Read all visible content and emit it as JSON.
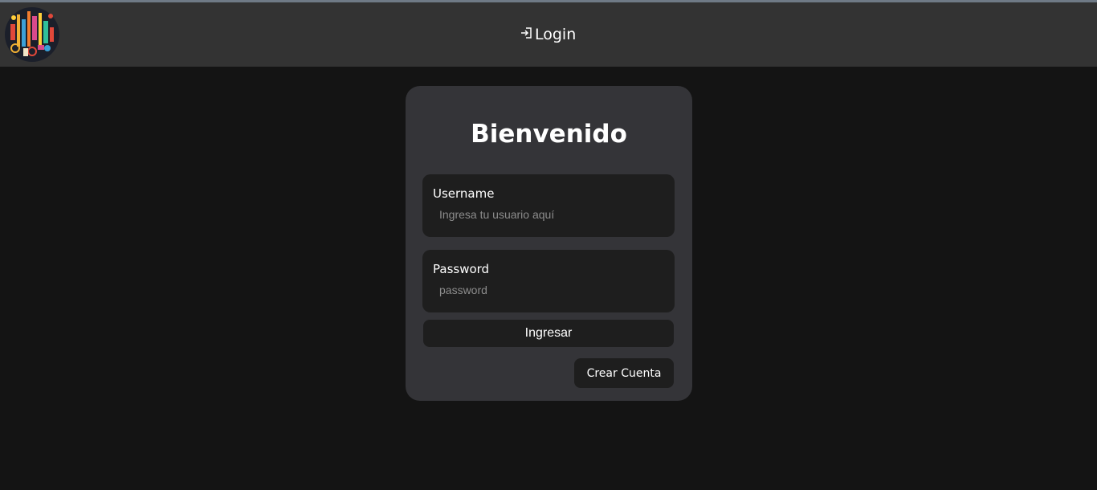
{
  "navbar": {
    "logo_icon": "tools-collage-logo",
    "login_icon": "login-arrow-icon",
    "login_label": "Login"
  },
  "card": {
    "title": "Bienvenido",
    "username": {
      "label": "Username",
      "placeholder": "Ingresa tu usuario aquí",
      "value": ""
    },
    "password": {
      "label": "Password",
      "placeholder": "password",
      "value": ""
    },
    "submit_label": "Ingresar",
    "create_account_label": "Crear Cuenta"
  },
  "colors": {
    "background": "#141414",
    "navbar": "#333333",
    "card": "#343438",
    "field": "#1e1e1e",
    "text": "#ffffff",
    "placeholder": "#8c8c8c"
  }
}
